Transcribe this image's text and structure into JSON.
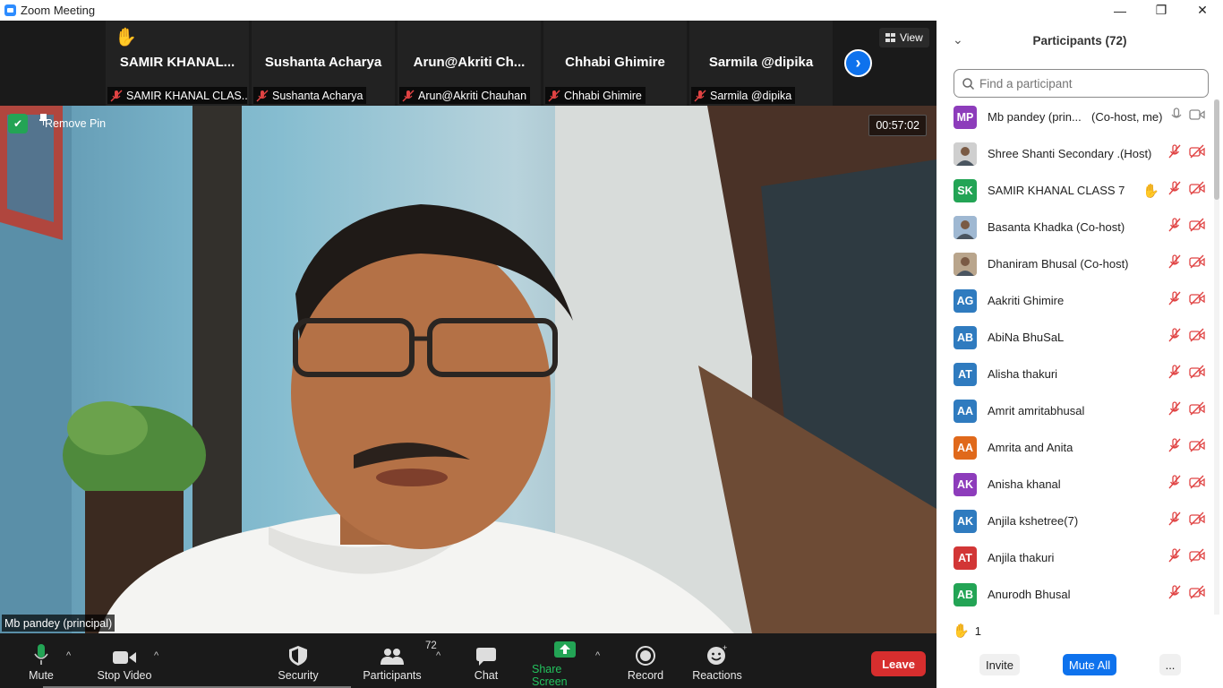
{
  "window": {
    "title": "Zoom Meeting",
    "minimize": "—",
    "restore": "❐",
    "close": "✕"
  },
  "gallery": {
    "view_label": "View",
    "tiles": [
      {
        "name": "SAMIR KHANAL...",
        "label": "SAMIR KHANAL CLAS...",
        "hand_raised": true
      },
      {
        "name": "Sushanta Acharya",
        "label": "Sushanta Acharya"
      },
      {
        "name": "Arun@Akriti  Ch...",
        "label": "Arun@Akriti Chauhan"
      },
      {
        "name": "Chhabi Ghimire",
        "label": "Chhabi Ghimire"
      },
      {
        "name": "Sarmila @dipika",
        "label": "Sarmila @dipika"
      }
    ]
  },
  "main": {
    "remove_pin": "Remove Pin",
    "timer": "00:57:02",
    "speaker_label": "Mb pandey (principal)"
  },
  "toolbar": {
    "mute": "Mute",
    "stop_video": "Stop Video",
    "security": "Security",
    "participants": "Participants",
    "participant_count": "72",
    "chat": "Chat",
    "share_screen": "Share Screen",
    "record": "Record",
    "reactions": "Reactions",
    "leave": "Leave"
  },
  "panel": {
    "title": "Participants (72)",
    "search_placeholder": "Find a participant",
    "participants": [
      {
        "initials": "MP",
        "color": "#8d3cbb",
        "name": "Mb pandey (prin...",
        "role": "(Co-host, me)",
        "muted": false,
        "video_off": false,
        "photo": false
      },
      {
        "initials": "",
        "color": "#cfcfcf",
        "name": "Shree Shanti Secondary ...",
        "role": "(Host)",
        "muted": true,
        "video_off": true,
        "photo": true
      },
      {
        "initials": "SK",
        "color": "#23a455",
        "name": "SAMIR KHANAL CLASS 7",
        "role": "",
        "muted": true,
        "video_off": true,
        "photo": false,
        "hand": true
      },
      {
        "initials": "",
        "color": "#9fb8d2",
        "name": "Basanta Khadka (Co-host)",
        "role": "",
        "muted": true,
        "video_off": true,
        "photo": true
      },
      {
        "initials": "",
        "color": "#b9a58c",
        "name": "Dhaniram Bhusal (Co-host)",
        "role": "",
        "muted": true,
        "video_off": true,
        "photo": true
      },
      {
        "initials": "AG",
        "color": "#2f7bbf",
        "name": "Aakriti Ghimire",
        "role": "",
        "muted": true,
        "video_off": true,
        "photo": false
      },
      {
        "initials": "AB",
        "color": "#2f7bbf",
        "name": "AbiNa BhuSaL",
        "role": "",
        "muted": true,
        "video_off": true,
        "photo": false
      },
      {
        "initials": "AT",
        "color": "#2f7bbf",
        "name": "Alisha thakuri",
        "role": "",
        "muted": true,
        "video_off": true,
        "photo": false
      },
      {
        "initials": "AA",
        "color": "#2f7bbf",
        "name": "Amrit amritabhusal",
        "role": "",
        "muted": true,
        "video_off": true,
        "photo": false
      },
      {
        "initials": "AA",
        "color": "#e0691b",
        "name": "Amrita  and Anita",
        "role": "",
        "muted": true,
        "video_off": true,
        "photo": false
      },
      {
        "initials": "AK",
        "color": "#8d3cbb",
        "name": "Anisha khanal",
        "role": "",
        "muted": true,
        "video_off": true,
        "photo": false
      },
      {
        "initials": "AK",
        "color": "#2f7bbf",
        "name": "Anjila kshetree(7)",
        "role": "",
        "muted": true,
        "video_off": true,
        "photo": false
      },
      {
        "initials": "AT",
        "color": "#d23636",
        "name": "Anjila thakuri",
        "role": "",
        "muted": true,
        "video_off": true,
        "photo": false
      },
      {
        "initials": "AB",
        "color": "#23a455",
        "name": "Anurodh  Bhusal",
        "role": "",
        "muted": true,
        "video_off": true,
        "photo": false
      }
    ],
    "raised_hands": "1",
    "invite": "Invite",
    "mute_all": "Mute All",
    "more": "..."
  }
}
